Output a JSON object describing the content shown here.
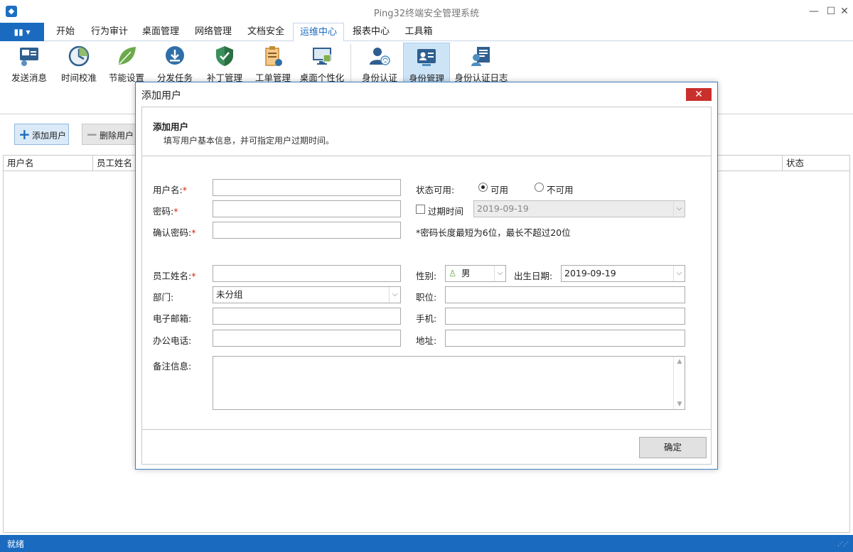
{
  "window": {
    "title": "Ping32终端安全管理系统",
    "minimize": "—",
    "maximize": "☐",
    "close": "✕"
  },
  "menu": {
    "app_button": "▮▮ ▾",
    "tabs": [
      {
        "label": "开始"
      },
      {
        "label": "行为审计"
      },
      {
        "label": "桌面管理"
      },
      {
        "label": "网络管理"
      },
      {
        "label": "文档安全"
      },
      {
        "label": "运维中心"
      },
      {
        "label": "报表中心"
      },
      {
        "label": "工具箱"
      }
    ],
    "active_tab": "运维中心"
  },
  "ribbon": {
    "items": [
      {
        "label": "发送消息",
        "icon": "send-message-icon"
      },
      {
        "label": "时间校准",
        "icon": "clock-icon"
      },
      {
        "label": "节能设置",
        "icon": "leaf-icon"
      },
      {
        "label": "分发任务",
        "icon": "download-icon"
      },
      {
        "label": "补丁管理",
        "icon": "shield-icon"
      },
      {
        "label": "工单管理",
        "icon": "clipboard-icon"
      },
      {
        "label": "桌面个性化",
        "icon": "monitor-icon"
      },
      {
        "label": "身份认证",
        "icon": "fingerprint-user-icon"
      },
      {
        "label": "身份管理",
        "icon": "id-card-icon"
      },
      {
        "label": "身份认证日志",
        "icon": "log-user-icon"
      }
    ],
    "active_item": "身份管理"
  },
  "toolbar": {
    "add_label": "添加用户",
    "delete_label": "删除用户"
  },
  "grid": {
    "columns": [
      "用户名",
      "员工姓名",
      "状态"
    ]
  },
  "statusbar": {
    "text": "就绪"
  },
  "dialog": {
    "title": "添加用户",
    "close": "✕",
    "header_title": "添加用户",
    "header_subtitle": "填写用户基本信息，并可指定用户过期时间。",
    "fields": {
      "username_label": "用户名:",
      "password_label": "密码:",
      "confirm_password_label": "确认密码:",
      "required_mark": "*",
      "status_label": "状态可用:",
      "status_options": [
        "可用",
        "不可用"
      ],
      "status_selected": "可用",
      "expire_label": "过期时间",
      "expire_value": "2019-09-19",
      "password_hint": "*密码长度最短为6位，最长不超过20位",
      "employee_name_label": "员工姓名:",
      "gender_label": "性别:",
      "gender_value": "男",
      "birth_label": "出生日期:",
      "birth_value": "2019-09-19",
      "dept_label": "部门:",
      "dept_value": "未分组",
      "position_label": "职位:",
      "email_label": "电子邮箱:",
      "mobile_label": "手机:",
      "office_phone_label": "办公电话:",
      "address_label": "地址:",
      "remark_label": "备注信息:"
    },
    "ok_label": "确定"
  },
  "colors": {
    "accent": "#1a6bbf",
    "close_red": "#c9302c",
    "active_ribbon": "#cde4f7"
  }
}
